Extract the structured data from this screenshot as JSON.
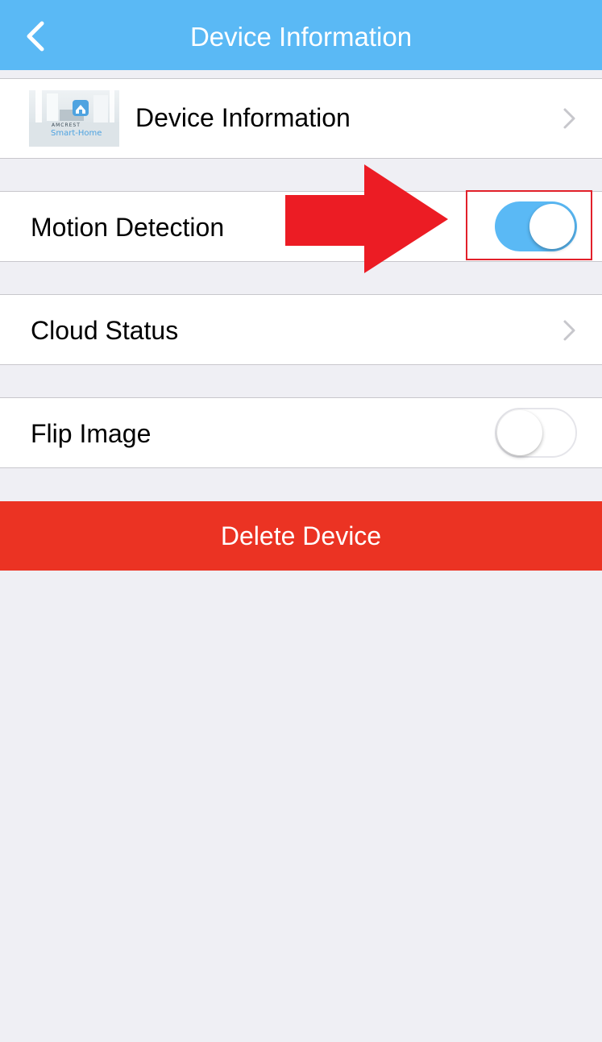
{
  "colors": {
    "navbar": "#5ab9f5",
    "background": "#efeff4",
    "toggle_on": "#5ab9f5",
    "delete": "#eb3323",
    "annotation": "#e2202a"
  },
  "navbar": {
    "title": "Device Information",
    "back_icon": "chevron-left-icon"
  },
  "device_cell": {
    "label": "Device Information",
    "thumbnail_brand": "AMCREST",
    "thumbnail_subtitle": "Smart-Home",
    "chevron_icon": "chevron-right-icon"
  },
  "motion_cell": {
    "label": "Motion Detection",
    "toggle_on": true
  },
  "cloud_cell": {
    "label": "Cloud Status",
    "chevron_icon": "chevron-right-icon"
  },
  "flip_cell": {
    "label": "Flip Image",
    "toggle_on": false
  },
  "delete_button": {
    "label": "Delete Device"
  },
  "annotation": {
    "arrow_icon": "arrow-right-icon",
    "highlight": "red-highlight-box"
  }
}
